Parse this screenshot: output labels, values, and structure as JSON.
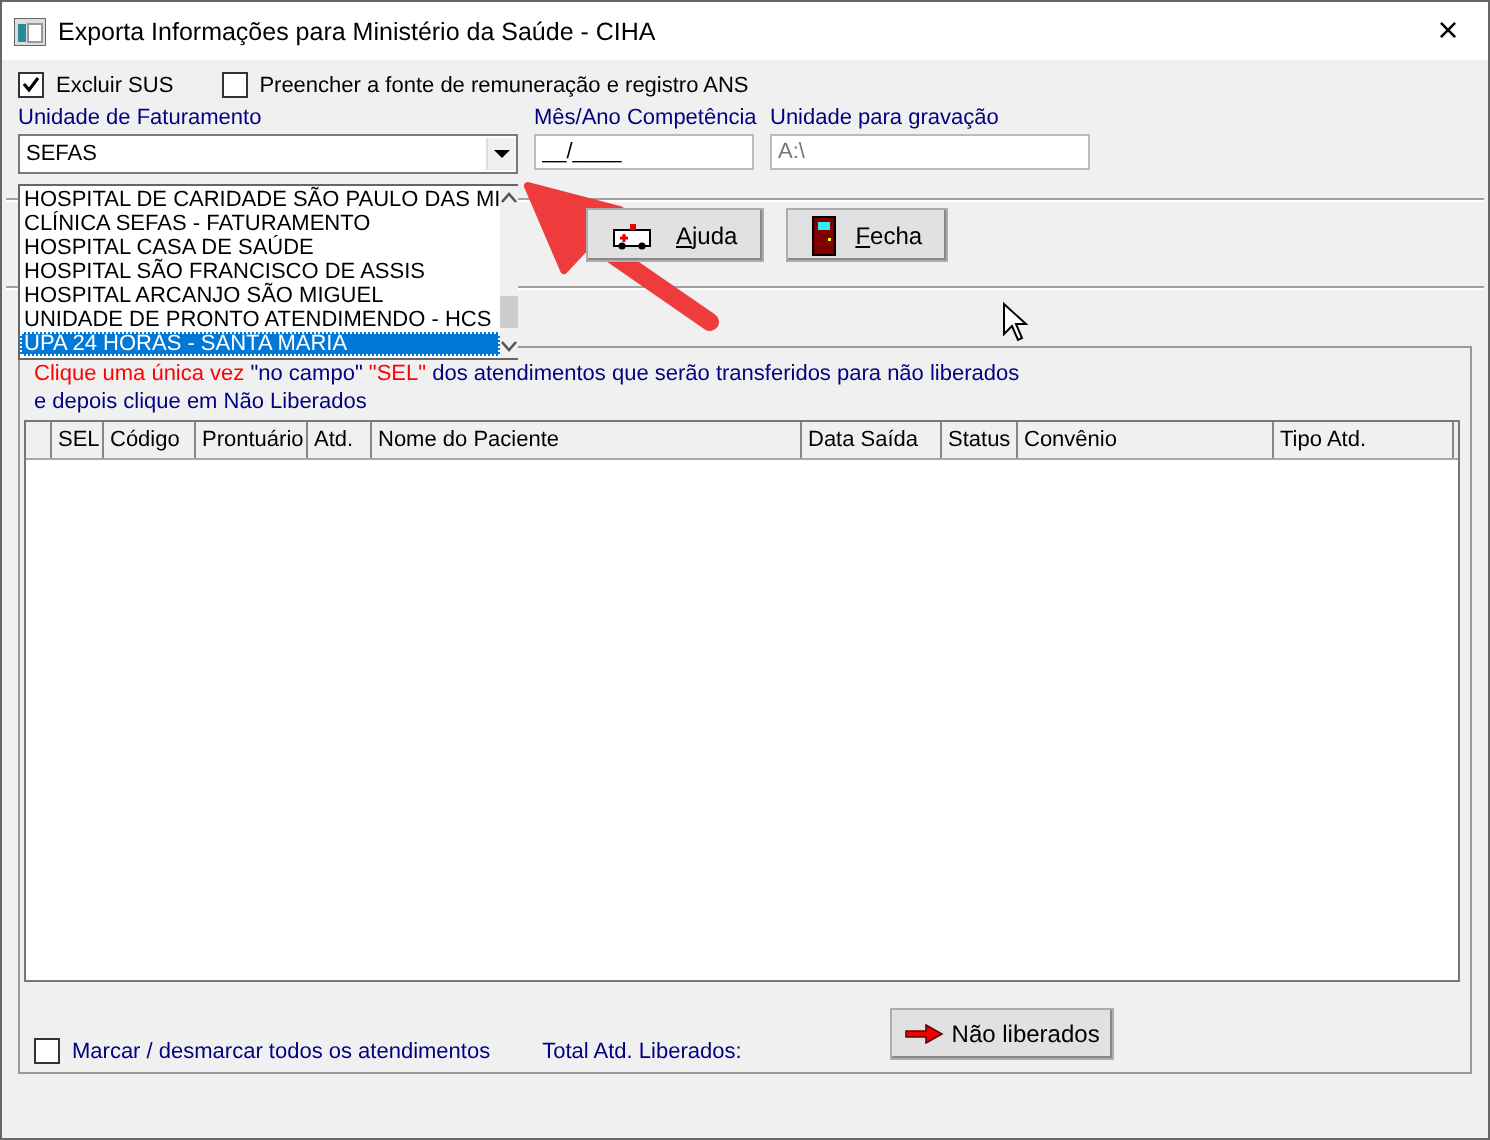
{
  "window": {
    "title": "Exporta Informações para Ministério da Saúde - CIHA",
    "close": "×"
  },
  "options": [
    {
      "label": "Excluir SUS",
      "checked": true
    },
    {
      "label": "Preencher a fonte de remuneração e registro ANS",
      "checked": false
    }
  ],
  "billing_unit": {
    "label": "Unidade de Faturamento",
    "value": "SEFAS",
    "items": [
      {
        "label": "HOSPITAL DE CARIDADE SÃO PAULO DAS MI",
        "selected": false
      },
      {
        "label": "CLÍNICA SEFAS - FATURAMENTO",
        "selected": false
      },
      {
        "label": "HOSPITAL CASA DE SAÚDE",
        "selected": false
      },
      {
        "label": "HOSPITAL SÃO FRANCISCO DE ASSIS",
        "selected": false
      },
      {
        "label": "HOSPITAL ARCANJO SÃO MIGUEL",
        "selected": false
      },
      {
        "label": "UNIDADE DE PRONTO ATENDIMENDO - HCS",
        "selected": false
      },
      {
        "label": "UPA 24 HORAS - SANTA MARIA",
        "selected": true
      }
    ]
  },
  "competence": {
    "label": "Mês/Ano Competência",
    "value": "__/____"
  },
  "recording_unit": {
    "label": "Unidade para gravação",
    "value": "A:\\",
    "disabled": true
  },
  "buttons": [
    {
      "label": "Ajuda",
      "kind": "help"
    },
    {
      "label": "Fecha",
      "kind": "close"
    }
  ],
  "instruction": [
    [
      {
        "text": "Clique uma única vez ",
        "color": "#ff0000"
      },
      {
        "text": "\"no campo\" ",
        "color": "#000080"
      },
      {
        "text": "\"SEL\" ",
        "color": "#ff0000"
      },
      {
        "text": "dos atendimentos que serão transferidos para não liberados",
        "color": "#000080"
      }
    ],
    [
      {
        "text": "e depois clique em Não Liberados",
        "color": "#000080"
      }
    ]
  ],
  "table": {
    "columns": [
      "SEL",
      "Código",
      "Prontuário",
      "Atd.",
      "Nome do Paciente",
      "Data Saída",
      "Status",
      "Convênio",
      "Tipo Atd."
    ]
  },
  "select_all": {
    "label": "Marcar / desmarcar todos os atendimentos",
    "checked": false
  },
  "total_label": "Total Atd. Liberados:",
  "release_button": "Não liberados"
}
